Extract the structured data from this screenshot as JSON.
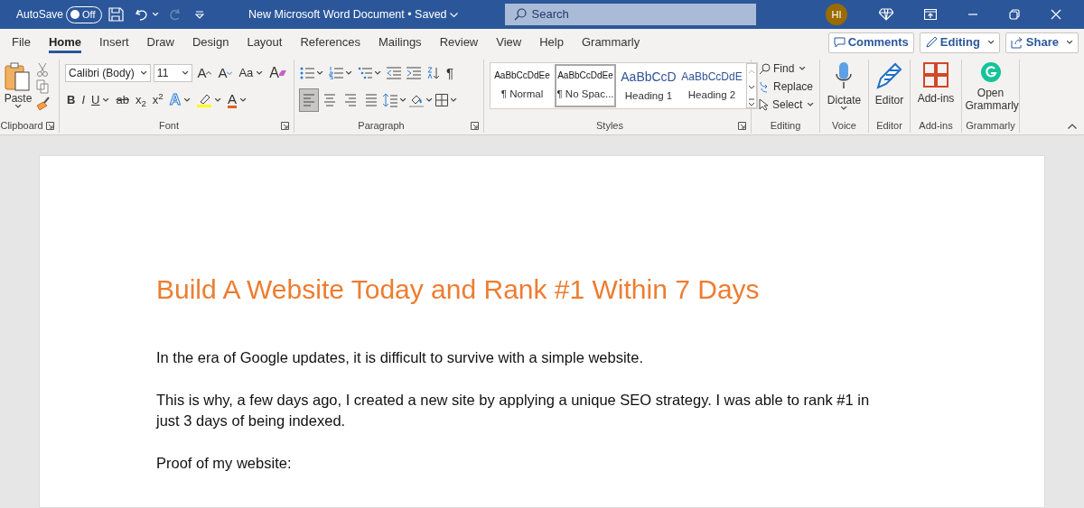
{
  "title_bar": {
    "autosave_label": "AutoSave",
    "autosave": {
      "on": false,
      "label": "Off"
    },
    "redo_disabled": true,
    "document_title": "New Microsoft Word Document • Saved",
    "search_placeholder": "Search",
    "avatar": "HI"
  },
  "tabs": [
    {
      "label": "File",
      "selected": false
    },
    {
      "label": "Home",
      "selected": true
    },
    {
      "label": "Insert",
      "selected": false
    },
    {
      "label": "Draw",
      "selected": false
    },
    {
      "label": "Design",
      "selected": false
    },
    {
      "label": "Layout",
      "selected": false
    },
    {
      "label": "References",
      "selected": false
    },
    {
      "label": "Mailings",
      "selected": false
    },
    {
      "label": "Review",
      "selected": false
    },
    {
      "label": "View",
      "selected": false
    },
    {
      "label": "Help",
      "selected": false
    },
    {
      "label": "Grammarly",
      "selected": false
    }
  ],
  "actions": [
    {
      "label": "Comments",
      "kind": "comments"
    },
    {
      "label": "Editing",
      "kind": "editing"
    },
    {
      "label": "Share",
      "kind": "share"
    }
  ],
  "ribbon": {
    "clipboard": {
      "paste": "Paste",
      "label": "Clipboard"
    },
    "font": {
      "font_name": "Calibri (Body)",
      "font_size": "11",
      "label": "Font",
      "row1": [
        {
          "label": "A",
          "kind": "grow"
        },
        {
          "label": "A",
          "kind": "shrink"
        },
        {
          "label": "Aa",
          "kind": "case"
        },
        {
          "label": "A",
          "kind": "clear"
        }
      ],
      "row2": [
        {
          "label": "B",
          "kind": "bold"
        },
        {
          "label": "I",
          "kind": "italic"
        },
        {
          "label": "U",
          "kind": "underline"
        },
        {
          "label": "ab",
          "kind": "strike"
        },
        {
          "label": "x$_{2}$",
          "kind": "sub"
        },
        {
          "label": "x$^{2}$",
          "kind": "sup"
        },
        {
          "label": "A",
          "kind": "effects"
        },
        {
          "kind": "highlight"
        },
        {
          "label": "A",
          "kind": "color"
        }
      ]
    },
    "paragraph": {
      "label": "Paragraph",
      "pilcrow": "¶",
      "alignments": [
        {
          "kind": "left",
          "selected": true
        },
        {
          "kind": "center",
          "selected": false
        },
        {
          "kind": "right",
          "selected": false
        },
        {
          "kind": "justify",
          "selected": false
        }
      ]
    },
    "styles": {
      "label": "Styles",
      "items": [
        {
          "preview": "AaBbCcDdEe",
          "name": "¶ Normal",
          "kind": "body",
          "selected": false
        },
        {
          "preview": "AaBbCcDdEe",
          "name": "¶ No Spac...",
          "kind": "body",
          "selected": true
        },
        {
          "preview": "AaBbCcD",
          "name": "Heading 1",
          "kind": "heading1",
          "selected": false
        },
        {
          "preview": "AaBbCcDdE",
          "name": "Heading 2",
          "kind": "heading2",
          "selected": false
        }
      ]
    },
    "editing": {
      "label": "Editing",
      "items": [
        {
          "label": "Find",
          "kind": "find"
        },
        {
          "label": "Replace",
          "kind": "replace"
        },
        {
          "label": "Select",
          "kind": "select"
        }
      ]
    },
    "big_groups": [
      {
        "button": "Dictate",
        "label": "Voice",
        "kind": "mic"
      },
      {
        "button": "Editor",
        "label": "Editor",
        "kind": "pen"
      },
      {
        "button": "Add-ins",
        "label": "Add-ins",
        "kind": "grid"
      },
      {
        "button": "Open Grammarly",
        "label": "Grammarly",
        "kind": "logo"
      }
    ]
  },
  "document": {
    "heading": "Build A Website Today and Rank #1 Within 7 Days",
    "paragraphs": [
      "In the era of Google updates, it is difficult to survive with a simple website.",
      "This is why, a few days ago, I created a new site by applying a unique SEO strategy. I was able to rank #1 in just 3 days of being indexed.",
      "Proof of my website:"
    ]
  }
}
